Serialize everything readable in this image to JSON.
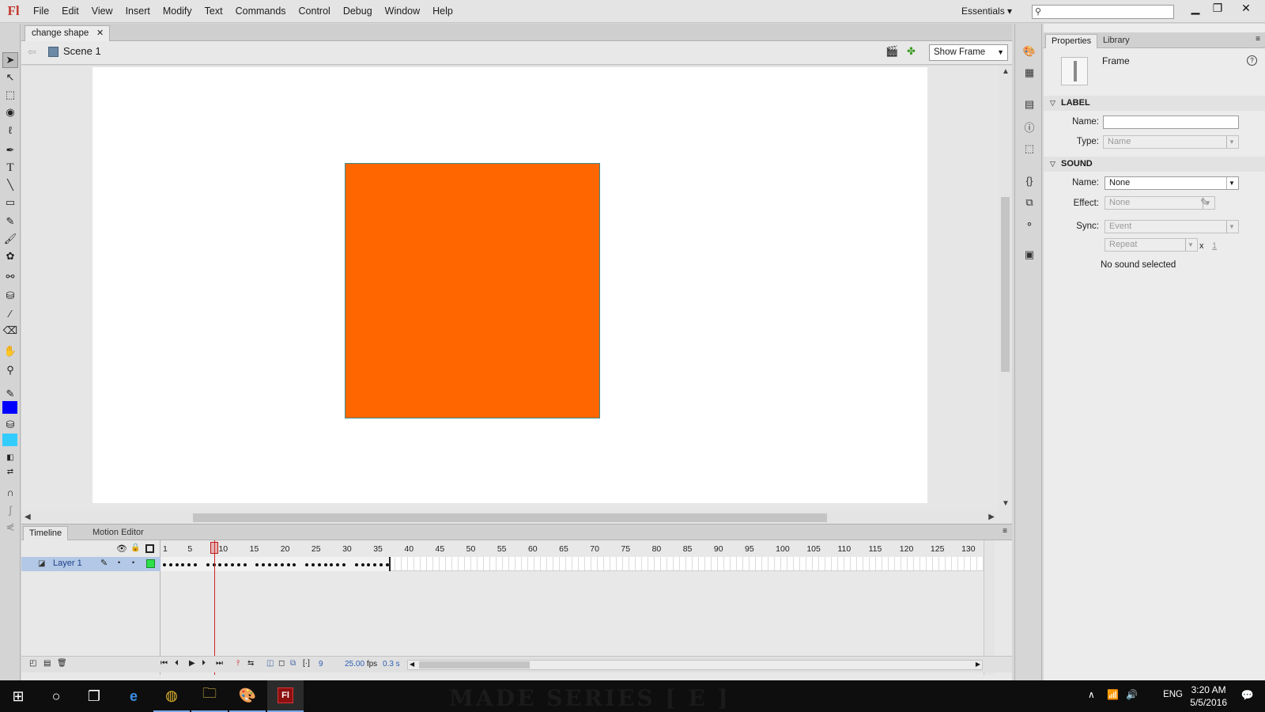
{
  "app": {
    "logo": "Fl",
    "title": "change shape"
  },
  "menu": [
    "File",
    "Edit",
    "View",
    "Insert",
    "Modify",
    "Text",
    "Commands",
    "Control",
    "Debug",
    "Window",
    "Help"
  ],
  "workspace": "Essentials",
  "workspace_caret": "▾",
  "search": {
    "placeholder": "",
    "icon": "search-icon"
  },
  "window_controls": {
    "minimize": "▁",
    "restore": "❐",
    "close": "✕"
  },
  "tools": [
    "selection",
    "subselection",
    "free-transform",
    "3d-rotation",
    "lasso",
    "pen",
    "text",
    "line",
    "rectangle",
    "pencil",
    "brush",
    "deco",
    "bone",
    "paint-bucket",
    "eyedropper",
    "eraser",
    "hand",
    "zoom",
    "stroke-color",
    "fill-color",
    "swap-colors",
    "snap"
  ],
  "colors": {
    "stroke": "#0000ff",
    "fill": "#33ccff",
    "shape_fill": "#ff6600",
    "stage": "#ffffff"
  },
  "document": {
    "tab_title": "change shape",
    "tab_close": "✕",
    "scene": "Scene 1",
    "zoom": "Show Frame"
  },
  "timeline": {
    "tabs": [
      "Timeline",
      "Motion Editor"
    ],
    "ruler": [
      "1",
      "5",
      "10",
      "15",
      "20",
      "25",
      "30",
      "35",
      "40",
      "45",
      "50",
      "55",
      "60",
      "65",
      "70",
      "75",
      "80",
      "85",
      "90",
      "95",
      "100",
      "105",
      "110",
      "115",
      "120",
      "125",
      "130"
    ],
    "layer_name": "Layer 1",
    "current_frame": "9",
    "fps": "25.00",
    "fps_unit": "fps",
    "elapsed": "0.3 s",
    "total_frames": 37
  },
  "properties": {
    "tabs": [
      "Properties",
      "Library"
    ],
    "object_type": "Frame",
    "label_section": "LABEL",
    "label_name_label": "Name:",
    "label_name_value": "",
    "label_type_label": "Type:",
    "label_type_value": "Name",
    "sound_section": "SOUND",
    "sound_name_label": "Name:",
    "sound_name_value": "None",
    "effect_label": "Effect:",
    "effect_value": "None",
    "sync_label": "Sync:",
    "sync_value": "Event",
    "repeat_value": "Repeat",
    "repeat_x": "x",
    "repeat_count": "1",
    "status": "No sound selected"
  },
  "taskbar": {
    "wallpaper_text": "MADE SERIES [ E ]",
    "apps": [
      "windows-start",
      "cortana",
      "task-view",
      "edge",
      "chrome",
      "file-explorer",
      "paint",
      "flash"
    ],
    "language": "ENG",
    "time": "3:20 AM",
    "date": "5/5/2016"
  }
}
